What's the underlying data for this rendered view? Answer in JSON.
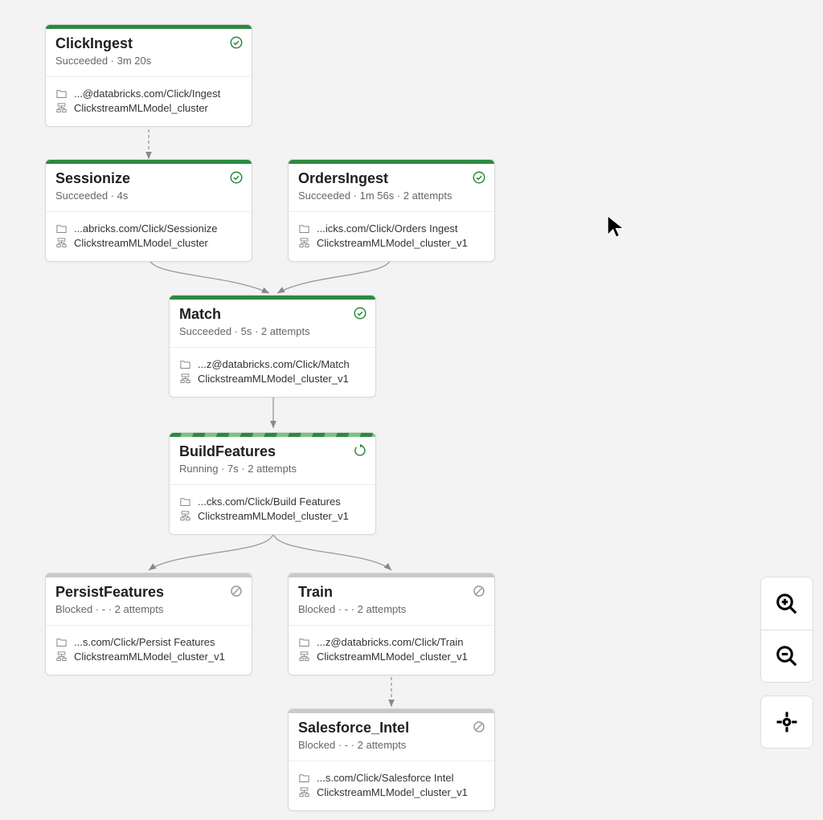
{
  "nodes": {
    "clickIngest": {
      "title": "ClickIngest",
      "status": "Succeeded · 3m 20s",
      "state": "succeeded",
      "path": "...@databricks.com/Click/Ingest",
      "cluster": "ClickstreamMLModel_cluster"
    },
    "sessionize": {
      "title": "Sessionize",
      "status": "Succeeded · 4s",
      "state": "succeeded",
      "path": "...abricks.com/Click/Sessionize",
      "cluster": "ClickstreamMLModel_cluster"
    },
    "ordersIngest": {
      "title": "OrdersIngest",
      "status": "Succeeded · 1m 56s · 2 attempts",
      "state": "succeeded",
      "path": "...icks.com/Click/Orders Ingest",
      "cluster": "ClickstreamMLModel_cluster_v1"
    },
    "match": {
      "title": "Match",
      "status": "Succeeded · 5s · 2 attempts",
      "state": "succeeded",
      "path": "...z@databricks.com/Click/Match",
      "cluster": "ClickstreamMLModel_cluster_v1"
    },
    "buildFeatures": {
      "title": "BuildFeatures",
      "status": "Running · 7s · 2 attempts",
      "state": "running",
      "path": "...cks.com/Click/Build Features",
      "cluster": "ClickstreamMLModel_cluster_v1"
    },
    "persistFeatures": {
      "title": "PersistFeatures",
      "status": "Blocked · - · 2 attempts",
      "state": "blocked",
      "path": "...s.com/Click/Persist Features",
      "cluster": "ClickstreamMLModel_cluster_v1"
    },
    "train": {
      "title": "Train",
      "status": "Blocked · - · 2 attempts",
      "state": "blocked",
      "path": "...z@databricks.com/Click/Train",
      "cluster": "ClickstreamMLModel_cluster_v1"
    },
    "salesforceIntel": {
      "title": "Salesforce_Intel",
      "status": "Blocked · - · 2 attempts",
      "state": "blocked",
      "path": "...s.com/Click/Salesforce Intel",
      "cluster": "ClickstreamMLModel_cluster_v1"
    }
  },
  "controls": {
    "zoomInLabel": "Zoom in",
    "zoomOutLabel": "Zoom out",
    "centerLabel": "Center graph"
  }
}
